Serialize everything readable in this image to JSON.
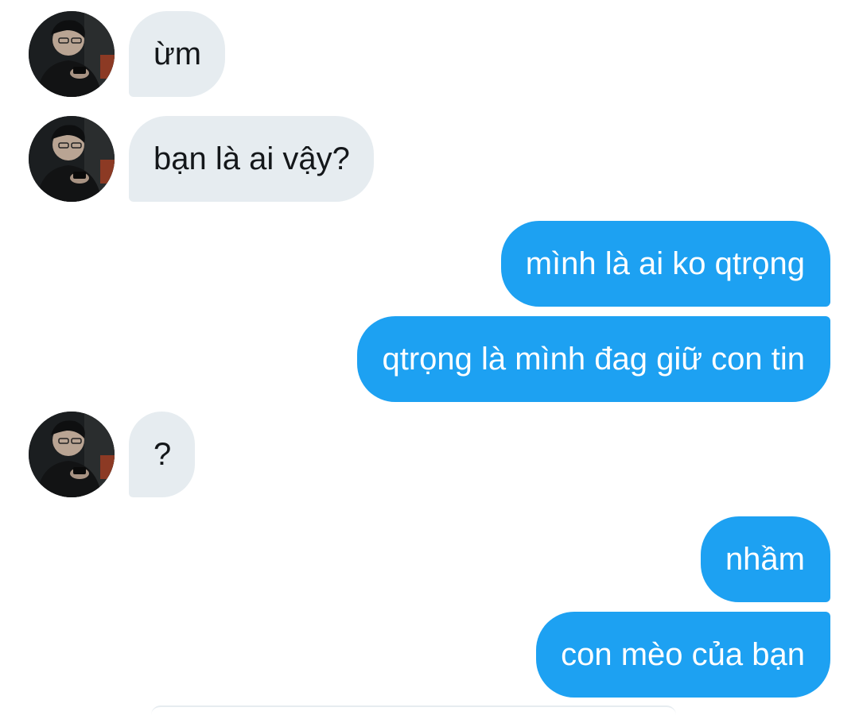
{
  "conversation": {
    "messages": [
      {
        "direction": "incoming",
        "text": "ừm"
      },
      {
        "direction": "incoming",
        "text": "bạn là ai vậy?"
      },
      {
        "direction": "outgoing",
        "text": "mình là ai ko qtrọng"
      },
      {
        "direction": "outgoing",
        "text": "qtrọng là mình đag giữ con tin"
      },
      {
        "direction": "incoming",
        "text": "?"
      },
      {
        "direction": "outgoing",
        "text": "nhầm"
      },
      {
        "direction": "outgoing",
        "text": "con mèo của bạn"
      }
    ]
  },
  "colors": {
    "incoming_bubble": "#e6ecf0",
    "incoming_text": "#14171a",
    "outgoing_bubble": "#1da1f2",
    "outgoing_text": "#ffffff",
    "background": "#ffffff"
  },
  "icons": {
    "avatar": "user-avatar-photo"
  }
}
